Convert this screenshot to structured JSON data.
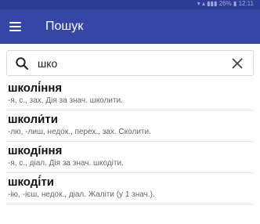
{
  "statusbar": {
    "text": "▾ ▴ ▮▮▮ 26% ▮ 12:11"
  },
  "appbar": {
    "title": "Пошук",
    "menu_icon": "hamburger-menu-icon"
  },
  "search": {
    "value": "шко",
    "placeholder": "",
    "search_icon": "search-icon",
    "clear_icon": "close-icon"
  },
  "results": [
    {
      "word": "школі́ння",
      "definition": "-я, с., зах. Дія за знач. школити."
    },
    {
      "word": "школи́ти",
      "definition": "-лю, -лиш, недок., перех., зах. Сколити."
    },
    {
      "word": "шкодíння",
      "definition": "-я, с., діал. Дія за знач. шкодіти."
    },
    {
      "word": "шкоді́ти",
      "definition": "-ію, -ієш, недок., діал. Жаліти (у 1 знач.)."
    }
  ],
  "colors": {
    "appbar": "#3646a6",
    "statusbar": "#2d3c97"
  }
}
